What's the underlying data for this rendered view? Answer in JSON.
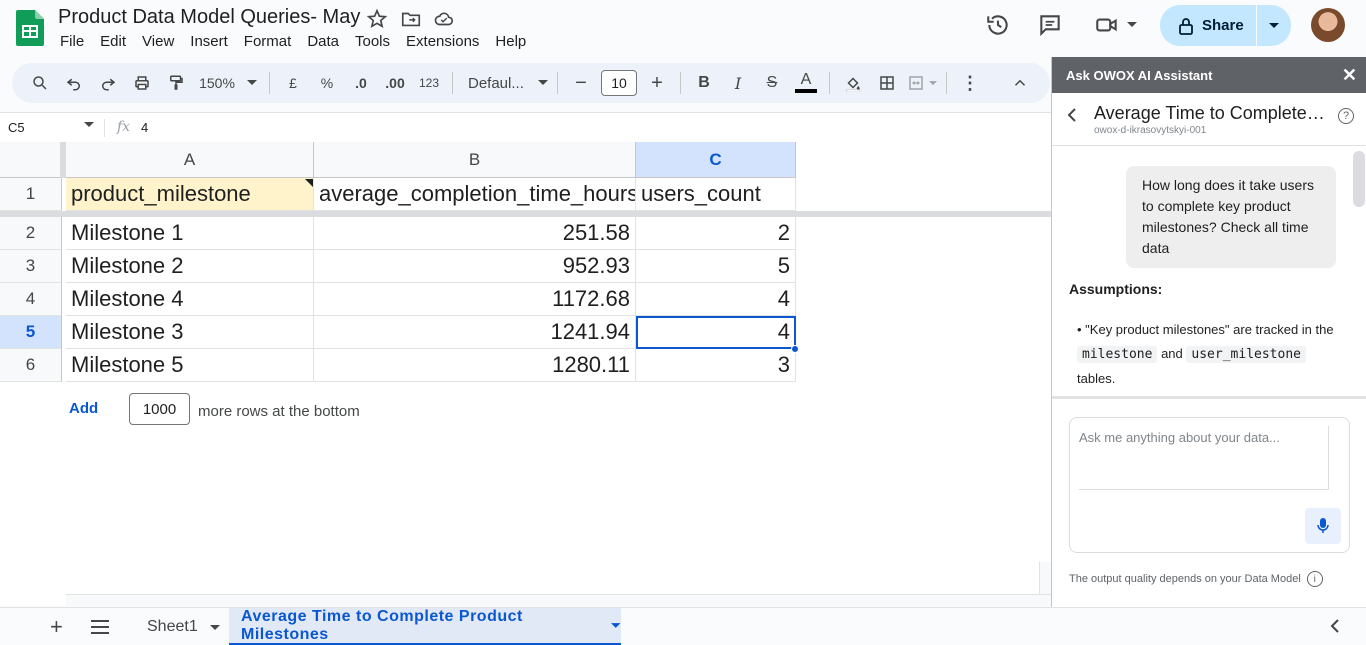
{
  "document": {
    "title": "Product Data Model Queries- May",
    "menu": [
      "File",
      "Edit",
      "View",
      "Insert",
      "Format",
      "Data",
      "Tools",
      "Extensions",
      "Help"
    ]
  },
  "header": {
    "share_label": "Share"
  },
  "toolbar": {
    "zoom": "150%",
    "currency": "£",
    "percent": "%",
    "dec_decrease": ".0",
    "dec_increase": ".00",
    "number_format": "123",
    "font": "Defaul...",
    "font_size": "10"
  },
  "formula_bar": {
    "cell_ref": "C5",
    "fx": "fx",
    "value": "4"
  },
  "grid": {
    "columns": [
      "A",
      "B",
      "C"
    ],
    "rows": [
      "1",
      "2",
      "3",
      "4",
      "5",
      "6"
    ],
    "header_row": [
      "product_milestone",
      "average_completion_time_hours",
      "users_count"
    ],
    "data": [
      [
        "Milestone 1",
        "251.58",
        "2"
      ],
      [
        "Milestone 2",
        "952.93",
        "5"
      ],
      [
        "Milestone 4",
        "1172.68",
        "4"
      ],
      [
        "Milestone 3",
        "1241.94",
        "4"
      ],
      [
        "Milestone 5",
        "1280.11",
        "3"
      ]
    ],
    "add_label": "Add",
    "add_count": "1000",
    "add_suffix": "more rows at the bottom"
  },
  "tabs": {
    "sheet1": "Sheet1",
    "active": "Average Time to Complete Product Milestones"
  },
  "panel": {
    "header": "Ask OWOX AI Assistant",
    "title": "Average Time to Complete P...",
    "subtitle": "owox-d-ikrasovytskyi-001",
    "question": "How long does it take users to complete key product milestones? Check all time data",
    "assumptions_label": "Assumptions:",
    "bullet_pre": "\"Key product milestones\" are tracked in the",
    "code1": "milestone",
    "bullet_mid": "and",
    "code2": "user_milestone",
    "bullet_post": "tables.",
    "ask_placeholder": "Ask me anything about your data...",
    "quality_note": "The output quality depends on your Data Model"
  },
  "colors": {
    "accent": "#0b57d0",
    "share_bg": "#c2e7ff",
    "sheets_green": "#0f9d58"
  }
}
